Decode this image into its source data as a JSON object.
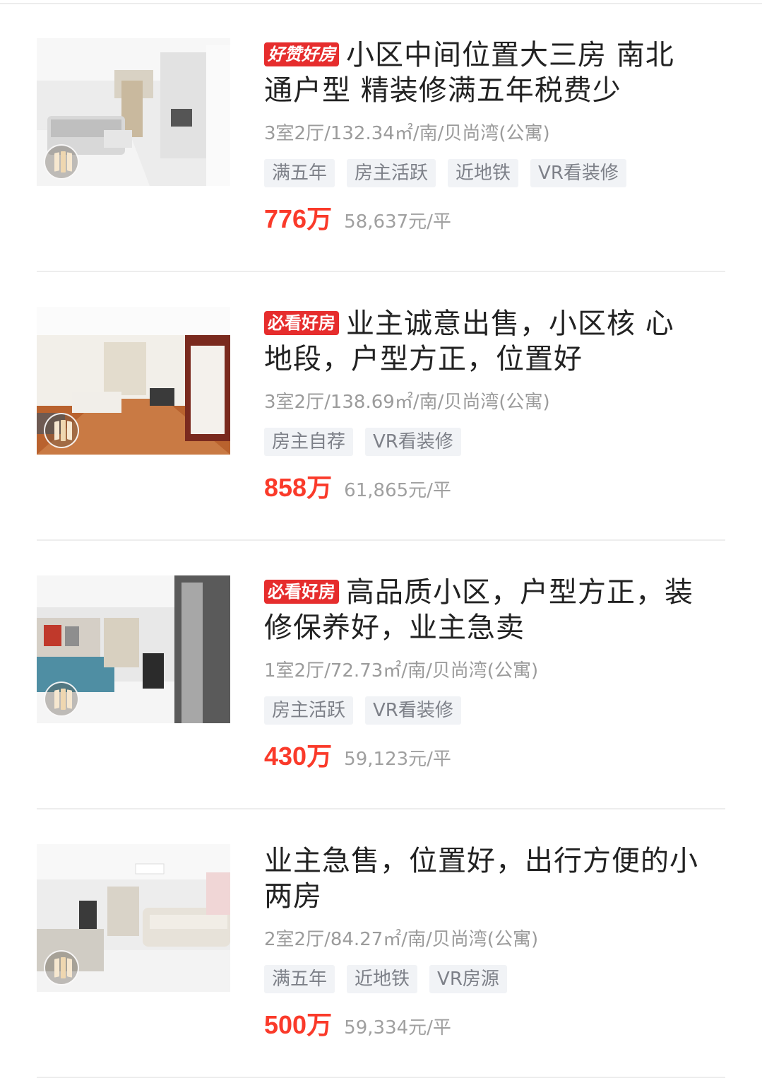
{
  "listings": [
    {
      "badge": "好赞好房",
      "title_line1": "小区中间位置大三房 南北",
      "title_line2": "通户型 精装修满五年税费少",
      "meta": "3室2厅/132.34㎡/南/贝尚湾(公寓)",
      "tags": [
        "满五年",
        "房主活跃",
        "近地铁",
        "VR看装修"
      ],
      "price": "776万",
      "unit_price": "58,637元/平"
    },
    {
      "badge": "必看好房",
      "title_line1": "业主诚意出售，小区核 心",
      "title_line2": "地段，户型方正，位置好",
      "meta": "3室2厅/138.69㎡/南/贝尚湾(公寓)",
      "tags": [
        "房主自荐",
        "VR看装修"
      ],
      "price": "858万",
      "unit_price": "61,865元/平"
    },
    {
      "badge": "必看好房",
      "title_line1": "高品质小区，户型方正，装",
      "title_line2": "修保养好，业主急卖",
      "meta": "1室2厅/72.73㎡/南/贝尚湾(公寓)",
      "tags": [
        "房主活跃",
        "VR看装修"
      ],
      "price": "430万",
      "unit_price": "59,123元/平"
    },
    {
      "badge": "",
      "title_line1": "业主急售，位置好，出行方便的小",
      "title_line2": "两房",
      "meta": "2室2厅/84.27㎡/南/贝尚湾(公寓)",
      "tags": [
        "满五年",
        "近地铁",
        "VR房源"
      ],
      "price": "500万",
      "unit_price": "59,334元/平"
    }
  ],
  "colors": {
    "price": "#fa3a2a",
    "badge_bg": "#e62d2d",
    "tag_bg": "#f1f3f6",
    "tag_text": "#7d8088",
    "meta_text": "#9b9b9b"
  },
  "icons": {
    "photo_overlay": "vr-panorama-icon"
  }
}
